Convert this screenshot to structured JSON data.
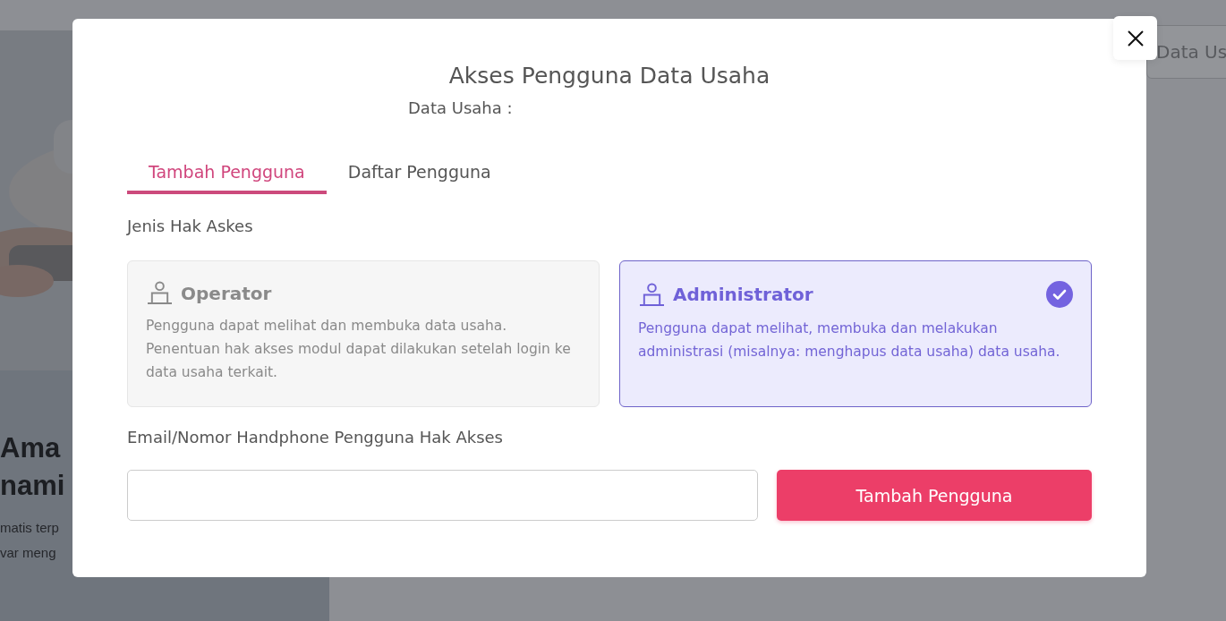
{
  "background": {
    "nav_button": "Data Us",
    "headline_lines": [
      "Ama",
      "nami"
    ],
    "body_lines": [
      "matis terp",
      "var meng"
    ]
  },
  "dialog": {
    "title": "Akses Pengguna Data Usaha",
    "subtitle": "Data Usaha :",
    "tabs": [
      {
        "label": "Tambah Pengguna",
        "selected": true
      },
      {
        "label": "Daftar Pengguna",
        "selected": false
      }
    ],
    "access_label": "Jenis Hak Askes",
    "access_options": [
      {
        "title": "Operator",
        "description": "Pengguna dapat melihat dan membuka data usaha. Penentuan hak akses modul dapat dilakukan setelah login ke data usaha terkait.",
        "selected": false
      },
      {
        "title": "Administrator",
        "description": "Pengguna dapat melihat, membuka dan melakukan administrasi (misalnya: menghapus data usaha) data usaha.",
        "selected": true
      }
    ],
    "contact_label": "Email/Nomor Handphone Pengguna Hak Akses",
    "submit_button": "Tambah Pengguna"
  }
}
